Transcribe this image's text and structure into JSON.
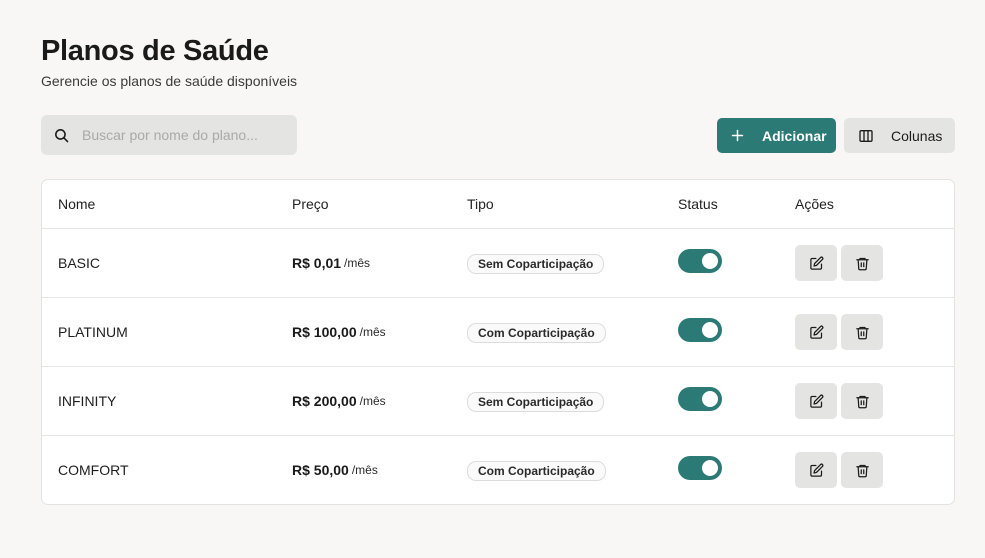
{
  "header": {
    "title": "Planos de Saúde",
    "subtitle": "Gerencie os planos de saúde disponíveis"
  },
  "search": {
    "placeholder": "Buscar por nome do plano...",
    "value": "",
    "icon": "search-icon"
  },
  "toolbar": {
    "add_label": "Adicionar",
    "add_icon": "plus-icon",
    "columns_label": "Colunas",
    "columns_icon": "columns-icon"
  },
  "colors": {
    "accent": "#2c7a76",
    "background": "#f8f7f5",
    "button_gray": "#e4e4e3"
  },
  "table": {
    "columns": [
      "Nome",
      "Preço",
      "Tipo",
      "Status",
      "Ações"
    ],
    "rows": [
      {
        "name": "BASIC",
        "price": "R$ 0,01",
        "unit": "/mês",
        "type": "Sem Coparticipação",
        "status": true
      },
      {
        "name": "PLATINUM",
        "price": "R$ 100,00",
        "unit": "/mês",
        "type": "Com Coparticipação",
        "status": true
      },
      {
        "name": "INFINITY",
        "price": "R$ 200,00",
        "unit": "/mês",
        "type": "Sem Coparticipação",
        "status": true
      },
      {
        "name": "COMFORT",
        "price": "R$ 50,00",
        "unit": "/mês",
        "type": "Com Coparticipação",
        "status": true
      }
    ],
    "row_actions": [
      "edit-icon",
      "trash-icon"
    ]
  }
}
